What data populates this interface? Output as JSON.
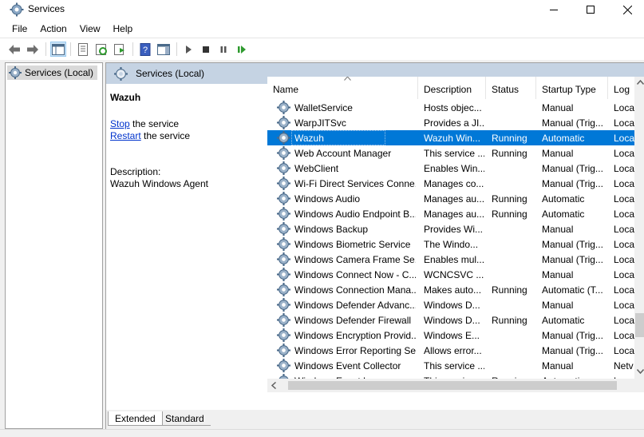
{
  "window": {
    "title": "Services"
  },
  "menu": [
    "File",
    "Action",
    "View",
    "Help"
  ],
  "tree": {
    "root": "Services (Local)"
  },
  "header": {
    "title": "Services (Local)"
  },
  "detail": {
    "service_name": "Wazuh",
    "stop_link": "Stop",
    "stop_rest": " the service",
    "restart_link": "Restart",
    "restart_rest": " the service",
    "description_label": "Description:",
    "description_text": "Wazuh Windows Agent"
  },
  "columns": [
    "Name",
    "Description",
    "Status",
    "Startup Type",
    "Log"
  ],
  "services": [
    {
      "name": "WalletService",
      "description": "Hosts objec...",
      "status": "",
      "startup": "Manual",
      "logon": "Loca"
    },
    {
      "name": "WarpJITSvc",
      "description": "Provides a JI...",
      "status": "",
      "startup": "Manual (Trig...",
      "logon": "Loca"
    },
    {
      "name": "Wazuh",
      "description": "Wazuh Win...",
      "status": "Running",
      "startup": "Automatic",
      "logon": "Loca",
      "selected": true
    },
    {
      "name": "Web Account Manager",
      "description": "This service ...",
      "status": "Running",
      "startup": "Manual",
      "logon": "Loca"
    },
    {
      "name": "WebClient",
      "description": "Enables Win...",
      "status": "",
      "startup": "Manual (Trig...",
      "logon": "Loca"
    },
    {
      "name": "Wi-Fi Direct Services Conne...",
      "description": "Manages co...",
      "status": "",
      "startup": "Manual (Trig...",
      "logon": "Loca"
    },
    {
      "name": "Windows Audio",
      "description": "Manages au...",
      "status": "Running",
      "startup": "Automatic",
      "logon": "Loca"
    },
    {
      "name": "Windows Audio Endpoint B...",
      "description": "Manages au...",
      "status": "Running",
      "startup": "Automatic",
      "logon": "Loca"
    },
    {
      "name": "Windows Backup",
      "description": "Provides Wi...",
      "status": "",
      "startup": "Manual",
      "logon": "Loca"
    },
    {
      "name": "Windows Biometric Service",
      "description": "The Windo...",
      "status": "",
      "startup": "Manual (Trig...",
      "logon": "Loca"
    },
    {
      "name": "Windows Camera Frame Se...",
      "description": "Enables mul...",
      "status": "",
      "startup": "Manual (Trig...",
      "logon": "Loca"
    },
    {
      "name": "Windows Connect Now - C...",
      "description": "WCNCSVC ...",
      "status": "",
      "startup": "Manual",
      "logon": "Loca"
    },
    {
      "name": "Windows Connection Mana...",
      "description": "Makes auto...",
      "status": "Running",
      "startup": "Automatic (T...",
      "logon": "Loca"
    },
    {
      "name": "Windows Defender Advanc...",
      "description": "Windows D...",
      "status": "",
      "startup": "Manual",
      "logon": "Loca"
    },
    {
      "name": "Windows Defender Firewall",
      "description": "Windows D...",
      "status": "Running",
      "startup": "Automatic",
      "logon": "Loca"
    },
    {
      "name": "Windows Encryption Provid...",
      "description": "Windows E...",
      "status": "",
      "startup": "Manual (Trig...",
      "logon": "Loca"
    },
    {
      "name": "Windows Error Reporting Se...",
      "description": "Allows error...",
      "status": "",
      "startup": "Manual (Trig...",
      "logon": "Loca"
    },
    {
      "name": "Windows Event Collector",
      "description": "This service ...",
      "status": "",
      "startup": "Manual",
      "logon": "Netv"
    },
    {
      "name": "Windows Event Log",
      "description": "This service ...",
      "status": "Running",
      "startup": "Automatic",
      "logon": "Loca"
    }
  ],
  "tabs": [
    "Extended",
    "Standard"
  ],
  "colors": {
    "selection": "#0078d7",
    "header_band": "#c5d3e3",
    "link": "#0033cc"
  }
}
